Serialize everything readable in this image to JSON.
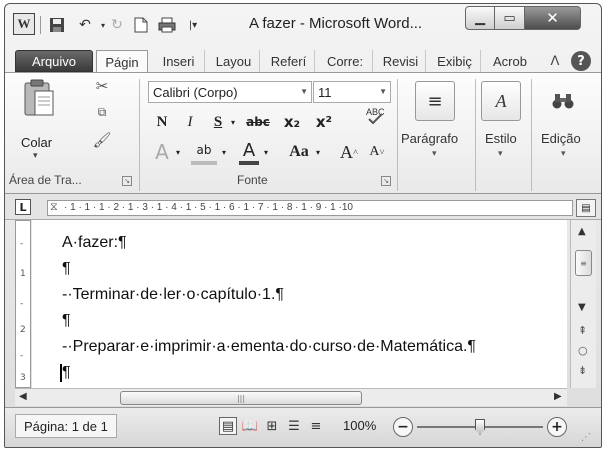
{
  "window": {
    "title": "A fazer - Microsoft Word..."
  },
  "quick_access": {
    "word_icon_text": "W"
  },
  "tabs": [
    "Arquivo",
    "Págin",
    "Inseri",
    "Layou",
    "Referí",
    "Corre:",
    "Revisi",
    "Exibiç",
    "Acrob"
  ],
  "active_tab": "Página Inicial",
  "ribbon": {
    "clipboard": {
      "paste_label": "Colar",
      "group_label": "Área de Tra..."
    },
    "font": {
      "font_name": "Calibri (Corpo)",
      "font_size": "11",
      "bold": "N",
      "italic": "I",
      "underline": "S",
      "strikethrough": "abc",
      "subscript": "x₂",
      "superscript": "x²",
      "text_effects": "A",
      "highlight": "ab",
      "font_color": "A",
      "change_case": "Aa",
      "grow_font": "A",
      "shrink_font": "A",
      "group_label": "Fonte"
    },
    "paragraph": {
      "label": "Parágrafo"
    },
    "styles": {
      "label": "Estilo"
    },
    "editing": {
      "label": "Edição"
    }
  },
  "ruler": {
    "marks": "· 1 · 1 · 1 · 2 · 1 · 3 · 1 · 4 · 1 · 5 · 1 · 6 · 1 · 7 · 1 · 8 · 1 · 9 · 1 ·10"
  },
  "vertical_ruler": {
    "marks": [
      "-",
      "1",
      "-",
      "2",
      "-",
      "3"
    ]
  },
  "document": {
    "lines": [
      "A·fazer:¶",
      "¶",
      "-·Terminar·de·ler·o·capítulo·1.¶",
      "¶",
      "-·Preparar·e·imprimir·a·ementa·do·curso·de·Matemática.¶",
      "¶"
    ]
  },
  "statusbar": {
    "page_count": "Página: 1 de 1",
    "zoom_level": "100%",
    "zoom_percent": 100
  },
  "colors": {
    "file_tab": "#4a4a4a",
    "close_button": "#5a5a5a",
    "page": "#ffffff"
  }
}
